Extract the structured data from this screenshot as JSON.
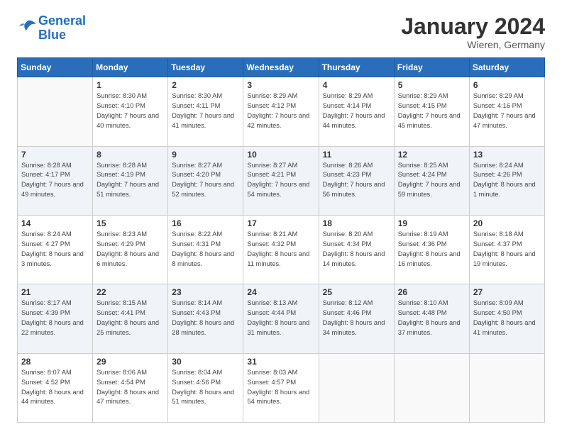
{
  "header": {
    "logo_line1": "General",
    "logo_line2": "Blue",
    "month": "January 2024",
    "location": "Wieren, Germany"
  },
  "days_of_week": [
    "Sunday",
    "Monday",
    "Tuesday",
    "Wednesday",
    "Thursday",
    "Friday",
    "Saturday"
  ],
  "weeks": [
    [
      {
        "day": "",
        "sunrise": "",
        "sunset": "",
        "daylight": ""
      },
      {
        "day": "1",
        "sunrise": "Sunrise: 8:30 AM",
        "sunset": "Sunset: 4:10 PM",
        "daylight": "Daylight: 7 hours and 40 minutes."
      },
      {
        "day": "2",
        "sunrise": "Sunrise: 8:30 AM",
        "sunset": "Sunset: 4:11 PM",
        "daylight": "Daylight: 7 hours and 41 minutes."
      },
      {
        "day": "3",
        "sunrise": "Sunrise: 8:29 AM",
        "sunset": "Sunset: 4:12 PM",
        "daylight": "Daylight: 7 hours and 42 minutes."
      },
      {
        "day": "4",
        "sunrise": "Sunrise: 8:29 AM",
        "sunset": "Sunset: 4:14 PM",
        "daylight": "Daylight: 7 hours and 44 minutes."
      },
      {
        "day": "5",
        "sunrise": "Sunrise: 8:29 AM",
        "sunset": "Sunset: 4:15 PM",
        "daylight": "Daylight: 7 hours and 45 minutes."
      },
      {
        "day": "6",
        "sunrise": "Sunrise: 8:29 AM",
        "sunset": "Sunset: 4:16 PM",
        "daylight": "Daylight: 7 hours and 47 minutes."
      }
    ],
    [
      {
        "day": "7",
        "sunrise": "Sunrise: 8:28 AM",
        "sunset": "Sunset: 4:17 PM",
        "daylight": "Daylight: 7 hours and 49 minutes."
      },
      {
        "day": "8",
        "sunrise": "Sunrise: 8:28 AM",
        "sunset": "Sunset: 4:19 PM",
        "daylight": "Daylight: 7 hours and 51 minutes."
      },
      {
        "day": "9",
        "sunrise": "Sunrise: 8:27 AM",
        "sunset": "Sunset: 4:20 PM",
        "daylight": "Daylight: 7 hours and 52 minutes."
      },
      {
        "day": "10",
        "sunrise": "Sunrise: 8:27 AM",
        "sunset": "Sunset: 4:21 PM",
        "daylight": "Daylight: 7 hours and 54 minutes."
      },
      {
        "day": "11",
        "sunrise": "Sunrise: 8:26 AM",
        "sunset": "Sunset: 4:23 PM",
        "daylight": "Daylight: 7 hours and 56 minutes."
      },
      {
        "day": "12",
        "sunrise": "Sunrise: 8:25 AM",
        "sunset": "Sunset: 4:24 PM",
        "daylight": "Daylight: 7 hours and 59 minutes."
      },
      {
        "day": "13",
        "sunrise": "Sunrise: 8:24 AM",
        "sunset": "Sunset: 4:26 PM",
        "daylight": "Daylight: 8 hours and 1 minute."
      }
    ],
    [
      {
        "day": "14",
        "sunrise": "Sunrise: 8:24 AM",
        "sunset": "Sunset: 4:27 PM",
        "daylight": "Daylight: 8 hours and 3 minutes."
      },
      {
        "day": "15",
        "sunrise": "Sunrise: 8:23 AM",
        "sunset": "Sunset: 4:29 PM",
        "daylight": "Daylight: 8 hours and 6 minutes."
      },
      {
        "day": "16",
        "sunrise": "Sunrise: 8:22 AM",
        "sunset": "Sunset: 4:31 PM",
        "daylight": "Daylight: 8 hours and 8 minutes."
      },
      {
        "day": "17",
        "sunrise": "Sunrise: 8:21 AM",
        "sunset": "Sunset: 4:32 PM",
        "daylight": "Daylight: 8 hours and 11 minutes."
      },
      {
        "day": "18",
        "sunrise": "Sunrise: 8:20 AM",
        "sunset": "Sunset: 4:34 PM",
        "daylight": "Daylight: 8 hours and 14 minutes."
      },
      {
        "day": "19",
        "sunrise": "Sunrise: 8:19 AM",
        "sunset": "Sunset: 4:36 PM",
        "daylight": "Daylight: 8 hours and 16 minutes."
      },
      {
        "day": "20",
        "sunrise": "Sunrise: 8:18 AM",
        "sunset": "Sunset: 4:37 PM",
        "daylight": "Daylight: 8 hours and 19 minutes."
      }
    ],
    [
      {
        "day": "21",
        "sunrise": "Sunrise: 8:17 AM",
        "sunset": "Sunset: 4:39 PM",
        "daylight": "Daylight: 8 hours and 22 minutes."
      },
      {
        "day": "22",
        "sunrise": "Sunrise: 8:15 AM",
        "sunset": "Sunset: 4:41 PM",
        "daylight": "Daylight: 8 hours and 25 minutes."
      },
      {
        "day": "23",
        "sunrise": "Sunrise: 8:14 AM",
        "sunset": "Sunset: 4:43 PM",
        "daylight": "Daylight: 8 hours and 28 minutes."
      },
      {
        "day": "24",
        "sunrise": "Sunrise: 8:13 AM",
        "sunset": "Sunset: 4:44 PM",
        "daylight": "Daylight: 8 hours and 31 minutes."
      },
      {
        "day": "25",
        "sunrise": "Sunrise: 8:12 AM",
        "sunset": "Sunset: 4:46 PM",
        "daylight": "Daylight: 8 hours and 34 minutes."
      },
      {
        "day": "26",
        "sunrise": "Sunrise: 8:10 AM",
        "sunset": "Sunset: 4:48 PM",
        "daylight": "Daylight: 8 hours and 37 minutes."
      },
      {
        "day": "27",
        "sunrise": "Sunrise: 8:09 AM",
        "sunset": "Sunset: 4:50 PM",
        "daylight": "Daylight: 8 hours and 41 minutes."
      }
    ],
    [
      {
        "day": "28",
        "sunrise": "Sunrise: 8:07 AM",
        "sunset": "Sunset: 4:52 PM",
        "daylight": "Daylight: 8 hours and 44 minutes."
      },
      {
        "day": "29",
        "sunrise": "Sunrise: 8:06 AM",
        "sunset": "Sunset: 4:54 PM",
        "daylight": "Daylight: 8 hours and 47 minutes."
      },
      {
        "day": "30",
        "sunrise": "Sunrise: 8:04 AM",
        "sunset": "Sunset: 4:56 PM",
        "daylight": "Daylight: 8 hours and 51 minutes."
      },
      {
        "day": "31",
        "sunrise": "Sunrise: 8:03 AM",
        "sunset": "Sunset: 4:57 PM",
        "daylight": "Daylight: 8 hours and 54 minutes."
      },
      {
        "day": "",
        "sunrise": "",
        "sunset": "",
        "daylight": ""
      },
      {
        "day": "",
        "sunrise": "",
        "sunset": "",
        "daylight": ""
      },
      {
        "day": "",
        "sunrise": "",
        "sunset": "",
        "daylight": ""
      }
    ]
  ]
}
